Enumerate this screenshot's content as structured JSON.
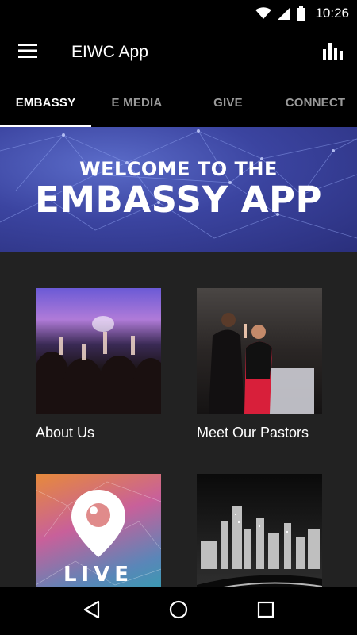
{
  "status_bar": {
    "time": "10:26",
    "icons": [
      "wifi-icon",
      "signal-icon",
      "battery-icon"
    ]
  },
  "app_bar": {
    "title": "EIWC App",
    "menu_icon": "hamburger-menu-icon",
    "action_icon": "bar-chart-icon"
  },
  "tabs": [
    {
      "label": "EMBASSY",
      "active": true
    },
    {
      "label": "E MEDIA",
      "active": false
    },
    {
      "label": "GIVE",
      "active": false
    },
    {
      "label": "CONNECT",
      "active": false
    }
  ],
  "banner": {
    "line1": "WELCOME TO THE",
    "line2": "EMBASSY APP"
  },
  "tiles": [
    {
      "label": "About Us",
      "image": "worship-crowd-image"
    },
    {
      "label": "Meet Our Pastors",
      "image": "pastors-image"
    },
    {
      "label": "",
      "image": "periscope-live-image",
      "overlay_text": "LIVE"
    },
    {
      "label": "",
      "image": "city-skyline-image"
    }
  ],
  "nav_bar": {
    "icons": [
      "back-icon",
      "home-icon",
      "recents-icon"
    ]
  },
  "colors": {
    "app_bar": "#000000",
    "content_bg": "#222222",
    "banner": "#3b44a0",
    "tab_inactive": "#9a9a9a",
    "tab_active": "#ffffff"
  }
}
